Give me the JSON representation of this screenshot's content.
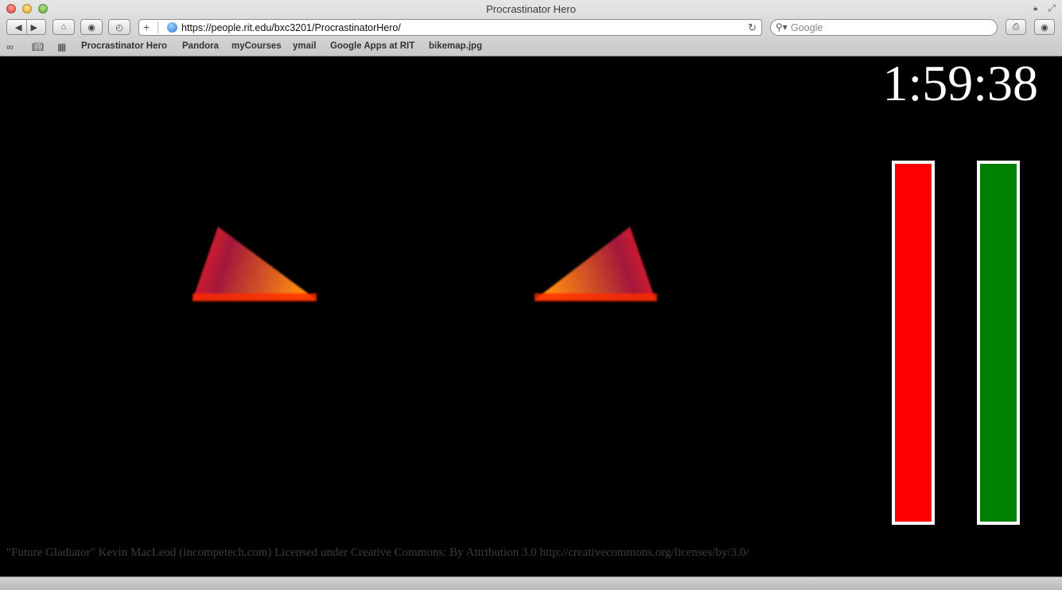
{
  "window": {
    "title": "Procrastinator Hero"
  },
  "toolbar": {
    "url": "https://people.rit.edu/bxc3201/ProcrastinatorHero/",
    "search_placeholder": "Google"
  },
  "bookmarks": [
    "Procrastinator Hero",
    "Pandora",
    "myCourses",
    "ymail",
    "Google Apps at RIT",
    "bikemap.jpg"
  ],
  "game": {
    "timer": "1:59:38",
    "bars": [
      {
        "color": "#ff0000",
        "level": 1.0
      },
      {
        "color": "#008000",
        "level": 1.0
      }
    ],
    "credits": "\"Future Gladiator\" Kevin MacLeod (incompetech.com) Licensed under Creative Commons: By Attribution 3.0 http://creativecommons.org/licenses/by/3.0/"
  },
  "icons": [
    "back-icon",
    "forward-icon",
    "home-icon",
    "open-icon",
    "history-icon",
    "add-icon",
    "globe-icon",
    "reload-icon",
    "search-icon",
    "print-icon",
    "settings-icon",
    "reading-list-icon",
    "bookmarks-book-icon",
    "top-sites-icon"
  ]
}
